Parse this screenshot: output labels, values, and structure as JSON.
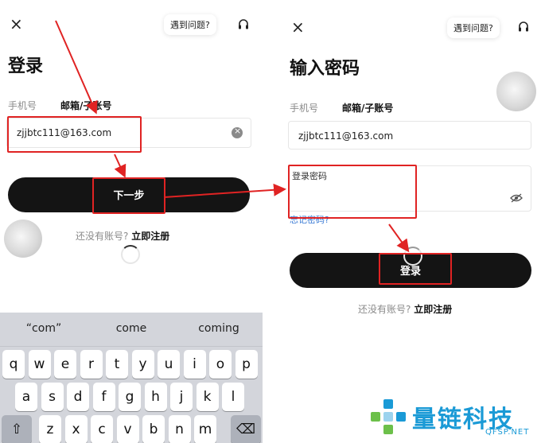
{
  "left_screen": {
    "close_label": "×",
    "help_label": "遇到问题?",
    "title": "登录",
    "tabs": {
      "phone": "手机号",
      "email": "邮箱/子账号"
    },
    "email_value": "zjjbtc111@163.com",
    "next_button": "下一步",
    "no_account": "还没有账号?",
    "register": "立即注册",
    "keyboard": {
      "suggestions": [
        "“com”",
        "come",
        "coming"
      ],
      "row1": [
        "q",
        "w",
        "e",
        "r",
        "t",
        "y",
        "u",
        "i",
        "o",
        "p"
      ],
      "row2": [
        "a",
        "s",
        "d",
        "f",
        "g",
        "h",
        "j",
        "k",
        "l"
      ],
      "row3": [
        "z",
        "x",
        "c",
        "v",
        "b",
        "n",
        "m"
      ],
      "shift_icon": "⇧",
      "delete_icon": "⌫"
    }
  },
  "right_screen": {
    "close_label": "×",
    "help_label": "遇到问题?",
    "title": "输入密码",
    "tabs": {
      "phone": "手机号",
      "email": "邮箱/子账号"
    },
    "email_value": "zjjbtc111@163.com",
    "password_label": "登录密码",
    "forgot": "忘记密码?",
    "login_button": "登录",
    "no_account": "还没有账号?",
    "register": "立即注册"
  },
  "watermark": {
    "brand": "量链科技",
    "site": "QFSP.NET"
  },
  "colors": {
    "annotation": "#e02323",
    "button": "#141414",
    "watermark": "#1a9ad6"
  },
  "icons": [
    "close-icon",
    "headset-icon",
    "clear-icon",
    "eye-off-icon",
    "shift-icon",
    "delete-icon"
  ]
}
